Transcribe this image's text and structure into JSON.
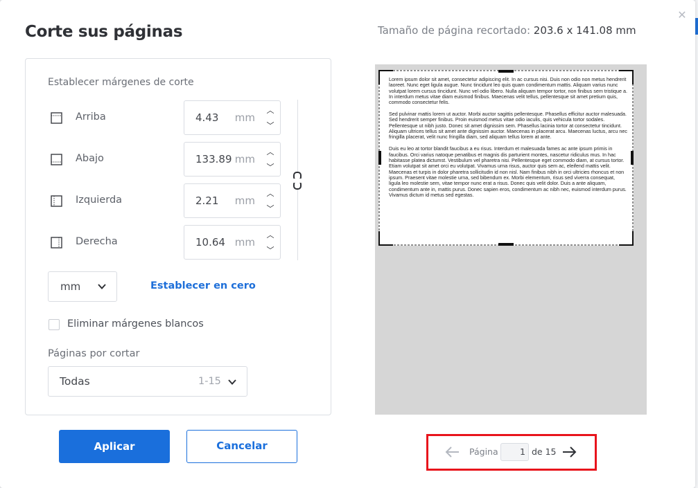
{
  "dialog": {
    "title": "Corte sus páginas",
    "close_icon": "close-icon"
  },
  "size_info": {
    "label": "Tamaño de página recortado:",
    "value": "203.6 x 141.08 mm"
  },
  "margins": {
    "section_label": "Establecer márgenes de corte",
    "rows": [
      {
        "label": "Arriba",
        "value": "4.43",
        "unit": "mm",
        "icon": "margin-top-icon"
      },
      {
        "label": "Abajo",
        "value": "133.89",
        "unit": "mm",
        "icon": "margin-bottom-icon"
      },
      {
        "label": "Izquierda",
        "value": "2.21",
        "unit": "mm",
        "icon": "margin-left-icon"
      },
      {
        "label": "Derecha",
        "value": "10.64",
        "unit": "mm",
        "icon": "margin-right-icon"
      }
    ],
    "unit_select": "mm",
    "reset_link": "Establecer en cero",
    "remove_white_margins": {
      "label": "Eliminar márgenes blancos",
      "checked": false
    }
  },
  "pages": {
    "label": "Páginas por cortar",
    "selected": "Todas",
    "range": "1-15"
  },
  "buttons": {
    "apply": "Aplicar",
    "cancel": "Cancelar"
  },
  "preview": {
    "paragraphs": [
      "Lorem ipsum dolor sit amet, consectetur adipiscing elit. In ac cursus nisi. Duis non odio non metus hendrerit laoreet. Nunc eget ligula augue. Nunc tincidunt leo quis quam condimentum mattis. Aliquam varius nunc volutpat lorem cursus tincidunt. Nunc vel odio libero. Nulla aliquam tempor tortor, non finibus sem tristique a. In interdum metus vitae diam euismod finibus. Maecenas velit tellus, pellentesque sit amet pretium quis, commodo consectetur felis.",
      "Sed pulvinar mattis lorem ut auctor. Morbi auctor sagittis pellentesque. Phasellus efficitur auctor malesuada. Sed hendrerit semper finibus. Proin euismod metus vitae odio iaculis, quis vehicula tortor sodales. Pellentesque ut nibh justo. Donec sit amet dignissim sem. Phasellus lacinia tortor at consectetur tincidunt. Aliquam ultrices tellus sit amet ante dignissim auctor. Maecenas in placerat arcu. Maecenas luctus, arcu nec fringilla placerat, velit nunc fringilla diam, sed aliquam tellus lorem at ante.",
      "Duis eu leo at tortor blandit faucibus a eu risus. Interdum et malesuada fames ac ante ipsum primis in faucibus. Orci varius natoque penatibus et magnis dis parturient montes, nascetur ridiculus mus. In hac habitasse platea dictumst. Vestibulum vel pharetra nisi. Pellentesque eget commodo diam, at cursus tortor. Etiam volutpat sit amet orci eu volutpat. Vivamus urna risus, auctor quis sem ac, eleifend mattis velit. Maecenas et turpis in dolor pharetra sollicitudin id non nisl. Nam finibus nibh in orci ultricies rhoncus et non ipsum. Praesent vitae molestie urna, sed bibendum ex. Morbi elementum, risus sed viverra consequat, ligula leo molestie sem, vitae tempor nunc erat a risus. Donec quis velit dolor. Duis a ante aliquam, condimentum ante in, mattis purus. Donec sapien eros, condimentum ac nibh nec, euismod interdum purus. Vivamus dictum id metus sed egestas."
    ]
  },
  "pager": {
    "label": "Página",
    "current": "1",
    "of": "de 15"
  },
  "colors": {
    "accent": "#1a6fdc",
    "highlight": "#e8141c"
  }
}
